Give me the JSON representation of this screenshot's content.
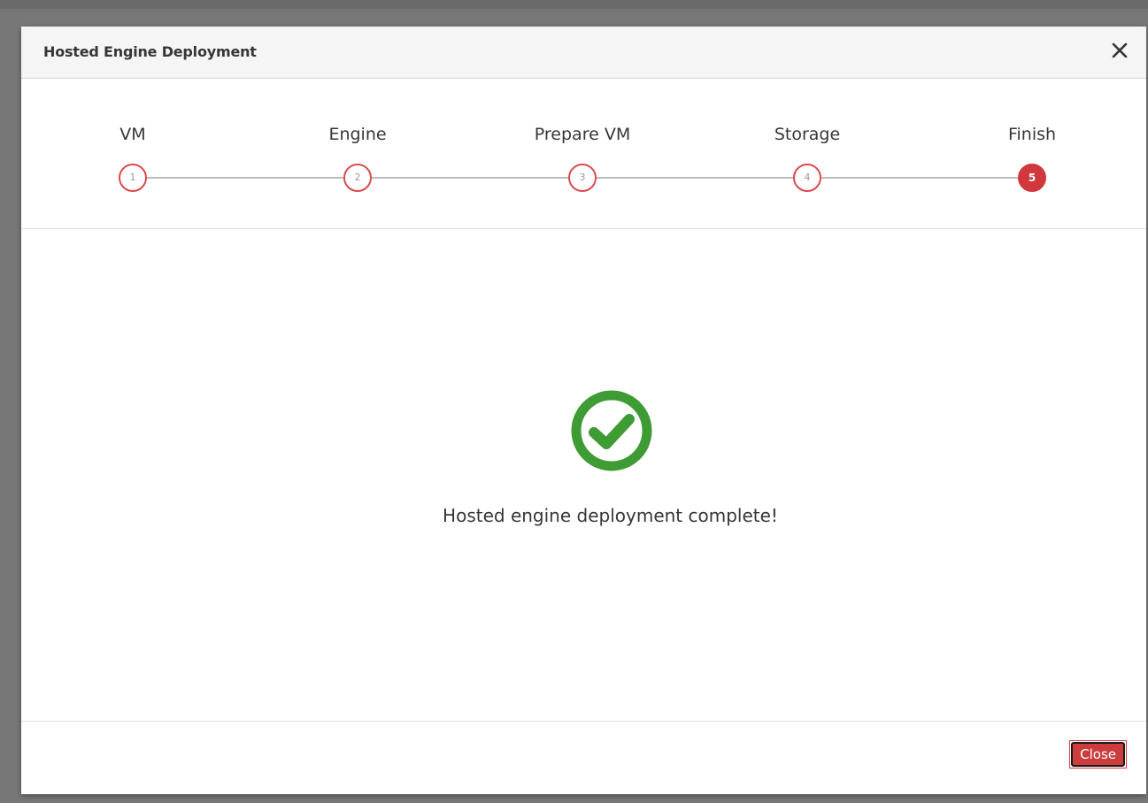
{
  "modal": {
    "title": "Hosted Engine Deployment",
    "close_icon": "close-icon"
  },
  "wizard": {
    "steps": [
      {
        "label": "VM",
        "number": "1",
        "state": "completed"
      },
      {
        "label": "Engine",
        "number": "2",
        "state": "completed"
      },
      {
        "label": "Prepare VM",
        "number": "3",
        "state": "completed"
      },
      {
        "label": "Storage",
        "number": "4",
        "state": "completed"
      },
      {
        "label": "Finish",
        "number": "5",
        "state": "active"
      }
    ]
  },
  "content": {
    "status_icon": "check-circle-icon",
    "message": "Hosted engine deployment complete!"
  },
  "footer": {
    "close_label": "Close"
  },
  "colors": {
    "accent": "#cc3d3d",
    "success": "#3f9c35",
    "step_border": "#d84c4c"
  }
}
